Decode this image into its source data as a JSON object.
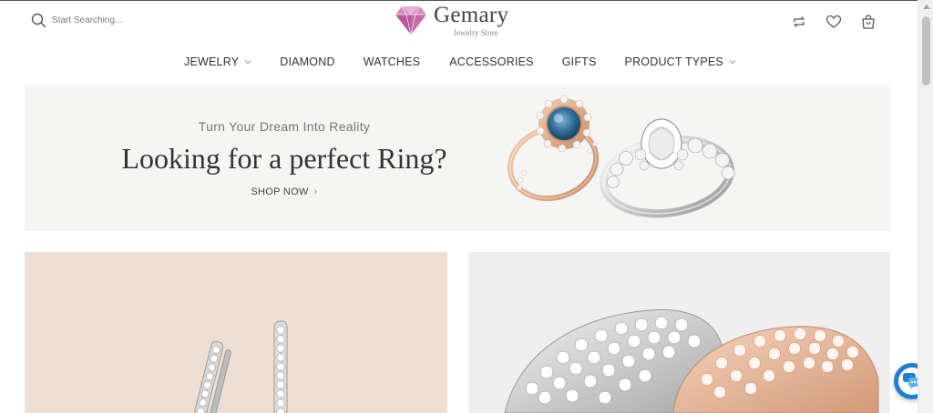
{
  "header": {
    "search_placeholder": "Start Searching...",
    "logo_name": "Gemary",
    "logo_tagline": "Jewelry Store",
    "icons": [
      "compare-icon",
      "wishlist-heart-icon",
      "shopping-bag-icon"
    ]
  },
  "nav": {
    "items": [
      {
        "label": "JEWELRY",
        "has_dropdown": true
      },
      {
        "label": "DIAMOND",
        "has_dropdown": false
      },
      {
        "label": "WATCHES",
        "has_dropdown": false
      },
      {
        "label": "ACCESSORIES",
        "has_dropdown": false
      },
      {
        "label": "GIFTS",
        "has_dropdown": false
      },
      {
        "label": "PRODUCT TYPES",
        "has_dropdown": true
      }
    ]
  },
  "hero": {
    "subtitle": "Turn Your Dream Into Reality",
    "title": "Looking for a perfect Ring?",
    "cta": "SHOP NOW"
  },
  "colors": {
    "logo_gem": "#c86aa8",
    "hero_bg": "#f5f5f3",
    "card_left_bg": "#eddfd4",
    "card_right_bg": "#efefef",
    "chat_blue": "#1f7fd2",
    "text_dark": "#333333"
  }
}
